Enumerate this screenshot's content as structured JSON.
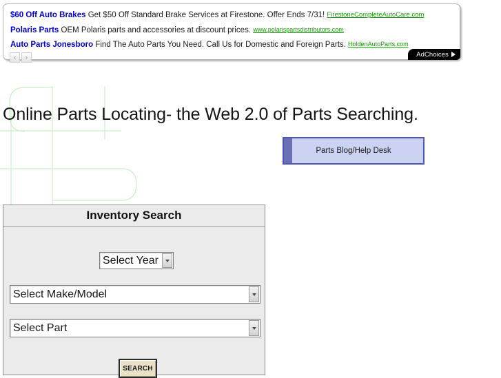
{
  "colors": {
    "ad_title": "#0000cc",
    "ad_link": "#12a000",
    "watermark": "#c8f0c8",
    "blog_button_fill": "#ccd2f2",
    "blog_button_border": "#4b55b5",
    "panel_bg": "#ebebeb",
    "search_button_fill": "#e8e1c8"
  },
  "ads": {
    "items": [
      {
        "title": "$60 Off Auto Brakes",
        "description": "Get $50 Off Standard Brake Services at Firestone. Offer Ends 7/31!",
        "link": "FirestoneCompleteAutoCare.com"
      },
      {
        "title": "Polaris Parts",
        "description": "OEM Polaris parts and accessories at discount prices.",
        "link": "www.polarispartsdistributors.com"
      },
      {
        "title": "Auto Parts Jonesboro",
        "description": "Find The Auto Parts You Need. Call Us for Domestic and Foreign Parts.",
        "link": "HoldenAutoParts.com"
      }
    ],
    "prev_label": "‹",
    "next_label": "›",
    "adchoices_label": "AdChoices"
  },
  "page": {
    "headline": "Online Parts Locating- the Web 2.0 of Parts Searching."
  },
  "blog_button": {
    "label": "Parts Blog/Help Desk"
  },
  "inventory_search": {
    "header": "Inventory Search",
    "fields": [
      {
        "name": "year",
        "value": "Select Year"
      },
      {
        "name": "make_model",
        "value": "Select Make/Model"
      },
      {
        "name": "part",
        "value": "Select Part"
      }
    ],
    "submit_label": "SEARCH"
  }
}
